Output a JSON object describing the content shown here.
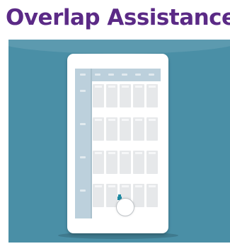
{
  "headline": {
    "text": "Overlap Assistance",
    "color": "#5b2a86"
  },
  "scene": {
    "background_color": "#4a8fa6"
  },
  "calendar": {
    "accent_color": "#bcd0dc",
    "columns": 5,
    "rows": 4,
    "highlight_color": "#1f8aa2",
    "icons": {
      "drag_marker": "drag-marker-icon",
      "drag_handle": "touch-circle-icon"
    }
  }
}
